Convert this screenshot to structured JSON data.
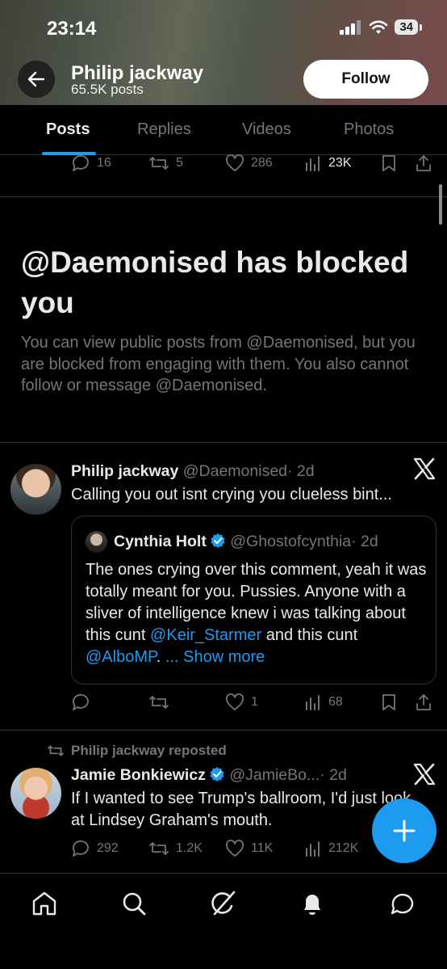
{
  "status_bar": {
    "time": "23:14",
    "battery": "34"
  },
  "header": {
    "profile_name": "Philip jackway",
    "posts_count": "65.5K posts",
    "follow_label": "Follow"
  },
  "tabs": [
    {
      "label": "Posts",
      "active": true
    },
    {
      "label": "Replies",
      "active": false
    },
    {
      "label": "Videos",
      "active": false
    },
    {
      "label": "Photos",
      "active": false
    }
  ],
  "top_post_actions": {
    "replies": "16",
    "reposts": "5",
    "likes": "286",
    "views": "23K"
  },
  "blocked_notice": {
    "title": "@Daemonised has blocked you",
    "description": "You can view public posts from @Daemonised, but you are blocked from engaging with them. You also cannot follow or message @Daemonised."
  },
  "tweet1": {
    "author": "Philip jackway",
    "handle": "@Daemonised",
    "time": "· 2d",
    "text": "Calling you out isnt crying you clueless bint...",
    "quote": {
      "author": "Cynthia Holt",
      "handle": "@Ghostofcynthia",
      "time": "· 2d",
      "text_part1": "The ones crying over this comment, yeah it was totally meant for you. Pussies. Anyone with a sliver of intelligence knew i was talking about this cunt ",
      "mention1": "@Keir_Starmer",
      "text_part2": " and this cunt ",
      "mention2": "@AlboMP",
      "text_part3": ". ",
      "show_more": "... Show more"
    },
    "actions": {
      "replies": "",
      "reposts": "",
      "likes": "1",
      "views": "68"
    }
  },
  "tweet2": {
    "repost_label": "Philip jackway reposted",
    "author": "Jamie Bonkiewicz",
    "handle": "@JamieBo...",
    "time": "· 2d",
    "text": "If I wanted to see Trump's ballroom, I'd just look at Lindsey Graham's mouth.",
    "actions": {
      "replies": "292",
      "reposts": "1.2K",
      "likes": "11K",
      "views": "212K"
    }
  },
  "fab_label": "+",
  "colors": {
    "accent": "#1d9bf0",
    "muted": "#71767b",
    "text": "#e7e9ea",
    "background": "#000000"
  }
}
